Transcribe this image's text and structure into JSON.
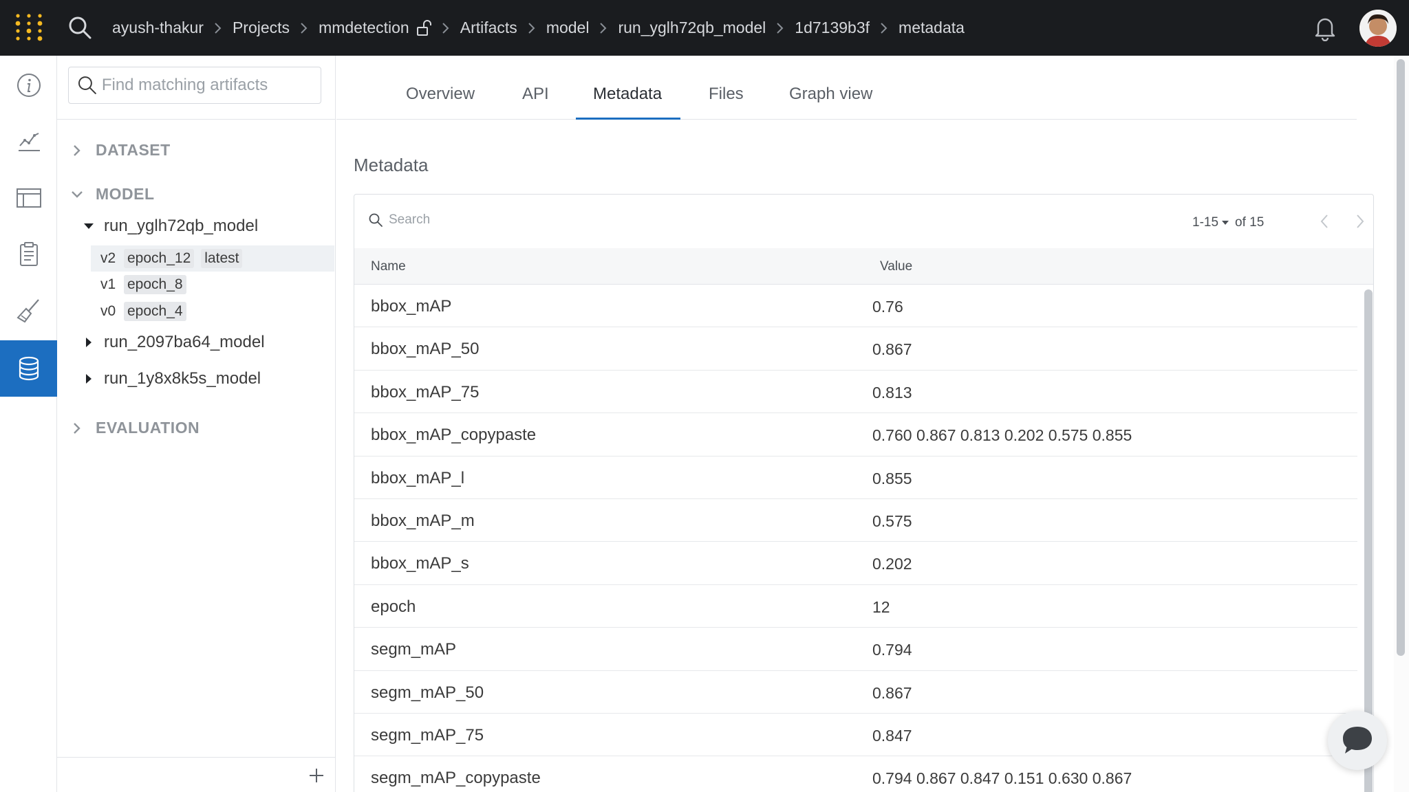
{
  "header": {
    "breadcrumb": [
      {
        "label": "ayush-thakur"
      },
      {
        "label": "Projects"
      },
      {
        "label": "mmdetection"
      },
      {
        "label": "Artifacts"
      },
      {
        "label": "model"
      },
      {
        "label": "run_yglh72qb_model"
      },
      {
        "label": "1d7139b3f"
      },
      {
        "label": "metadata"
      }
    ]
  },
  "sidebar": {
    "search_placeholder": "Find matching artifacts",
    "sections": {
      "dataset": "DATASET",
      "model": "MODEL",
      "evaluation": "EVALUATION"
    },
    "model_nodes": [
      {
        "label": "run_yglh72qb_model"
      },
      {
        "label": "run_2097ba64_model"
      },
      {
        "label": "run_1y8x8k5s_model"
      }
    ],
    "versions": [
      {
        "version": "v2",
        "tag": "epoch_12",
        "alias": "latest"
      },
      {
        "version": "v1",
        "tag": "epoch_8"
      },
      {
        "version": "v0",
        "tag": "epoch_4"
      }
    ]
  },
  "tabs": [
    {
      "label": "Overview"
    },
    {
      "label": "API"
    },
    {
      "label": "Metadata"
    },
    {
      "label": "Files"
    },
    {
      "label": "Graph view"
    }
  ],
  "main": {
    "title": "Metadata",
    "search_placeholder": "Search",
    "pager": {
      "range": "1-15",
      "total": "of 15"
    },
    "columns": {
      "name": "Name",
      "value": "Value"
    },
    "rows": [
      {
        "name": "bbox_mAP",
        "value": "0.76"
      },
      {
        "name": "bbox_mAP_50",
        "value": "0.867"
      },
      {
        "name": "bbox_mAP_75",
        "value": "0.813"
      },
      {
        "name": "bbox_mAP_copypaste",
        "value": "0.760 0.867 0.813 0.202 0.575 0.855"
      },
      {
        "name": "bbox_mAP_l",
        "value": "0.855"
      },
      {
        "name": "bbox_mAP_m",
        "value": "0.575"
      },
      {
        "name": "bbox_mAP_s",
        "value": "0.202"
      },
      {
        "name": "epoch",
        "value": "12"
      },
      {
        "name": "segm_mAP",
        "value": "0.794"
      },
      {
        "name": "segm_mAP_50",
        "value": "0.867"
      },
      {
        "name": "segm_mAP_75",
        "value": "0.847"
      },
      {
        "name": "segm_mAP_copypaste",
        "value": "0.794 0.867 0.847 0.151 0.630 0.867"
      }
    ]
  },
  "colors": {
    "topbar": "#1a1c1f",
    "accent": "#1c6ec0",
    "logo": "#f5b921"
  },
  "icons": {
    "logo": "wandb-dots-logo",
    "search": "search-icon",
    "lock": "unlock-icon",
    "bell": "bell-icon",
    "rail": [
      "info-icon",
      "chart-icon",
      "table-icon",
      "clipboard-icon",
      "sweep-broom-icon",
      "database-icon"
    ]
  }
}
